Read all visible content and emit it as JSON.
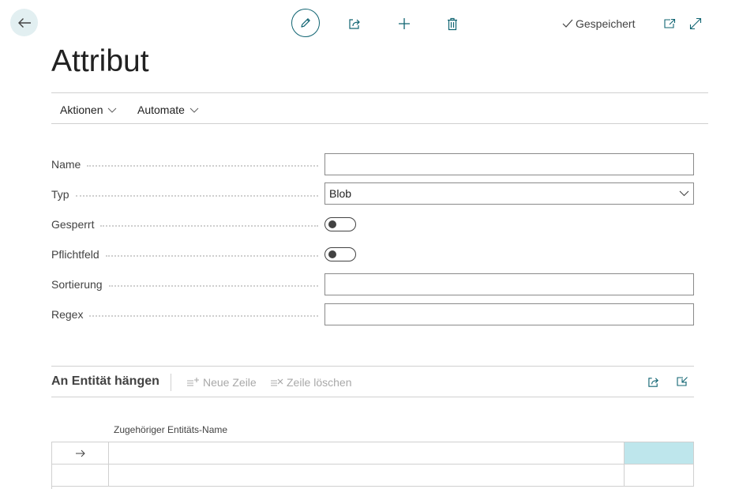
{
  "toolbar": {
    "saved_label": "Gespeichert"
  },
  "page": {
    "title": "Attribut"
  },
  "menu": {
    "actions_label": "Aktionen",
    "automate_label": "Automate"
  },
  "fields": {
    "name": {
      "label": "Name",
      "value": ""
    },
    "type": {
      "label": "Typ",
      "value": "Blob"
    },
    "locked": {
      "label": "Gesperrt",
      "value": "off"
    },
    "required": {
      "label": "Pflichtfeld",
      "value": "off"
    },
    "sorting": {
      "label": "Sortierung",
      "value": ""
    },
    "regex": {
      "label": "Regex",
      "value": ""
    }
  },
  "subpage": {
    "title": "An Entität hängen",
    "new_line_label": "Neue Zeile",
    "delete_line_label": "Zeile löschen",
    "column_header": "Zugehöriger Entitäts-Name",
    "rows": [
      {
        "current": true,
        "entity_name": ""
      },
      {
        "current": false,
        "entity_name": ""
      }
    ]
  },
  "colors": {
    "accent": "#106472",
    "selected_cell": "#bee6ec",
    "back_button_bg": "#e2eff1"
  },
  "icons": {
    "back": "arrow-left-icon",
    "edit": "pencil-icon",
    "share": "share-icon",
    "new": "plus-icon",
    "delete": "trash-icon",
    "saved": "checkmark-icon",
    "open_new_window": "open-in-new-window-icon",
    "expand": "expand-icon"
  }
}
